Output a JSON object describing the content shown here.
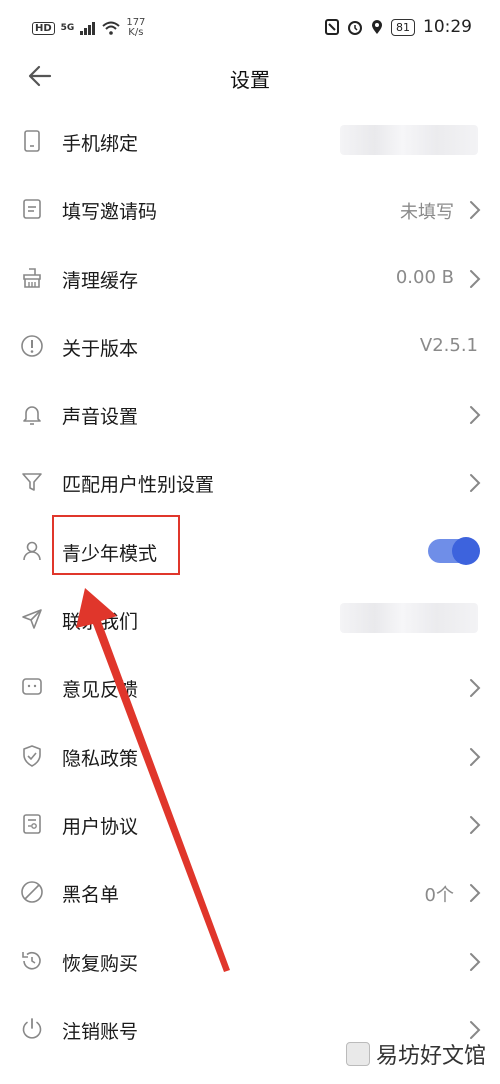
{
  "statusbar": {
    "left_badge": "HD",
    "network": "5G",
    "speed_value": "177",
    "speed_unit": "K/s",
    "battery": "81",
    "time": "10:29"
  },
  "header": {
    "title": "设置",
    "back_icon": "arrow-left-icon"
  },
  "settings": {
    "rows": [
      {
        "label": "手机绑定",
        "value": "",
        "icon": "phone-icon"
      },
      {
        "label": "填写邀请码",
        "value": "未填写",
        "icon": "document-icon"
      },
      {
        "label": "清理缓存",
        "value": "0.00 B",
        "icon": "broom-icon"
      },
      {
        "label": "关于版本",
        "value": "V2.5.1",
        "icon": "info-circle-icon"
      },
      {
        "label": "声音设置",
        "value": "",
        "icon": "bell-icon"
      },
      {
        "label": "匹配用户性别设置",
        "value": "",
        "icon": "funnel-icon"
      },
      {
        "label": "青少年模式",
        "value": "",
        "icon": "person-icon",
        "toggle_on": true
      },
      {
        "label": "联系我们",
        "value": "",
        "icon": "send-icon"
      },
      {
        "label": "意见反馈",
        "value": "",
        "icon": "feedback-icon"
      },
      {
        "label": "隐私政策",
        "value": "",
        "icon": "shield-check-icon"
      },
      {
        "label": "用户协议",
        "value": "",
        "icon": "agreement-icon"
      },
      {
        "label": "黑名单",
        "value": "0个",
        "icon": "block-icon"
      },
      {
        "label": "恢复购买",
        "value": "",
        "icon": "restore-icon"
      },
      {
        "label": "注销账号",
        "value": "",
        "icon": "power-icon"
      }
    ]
  },
  "annotation": {
    "highlight_color": "#e0362b",
    "arrow_color": "#e0362b"
  },
  "watermark": {
    "text": "易坊好文馆"
  },
  "colors": {
    "toggle_track": "#6f8ee8",
    "toggle_knob": "#3d63dd",
    "value_text": "#8a8a8a"
  }
}
